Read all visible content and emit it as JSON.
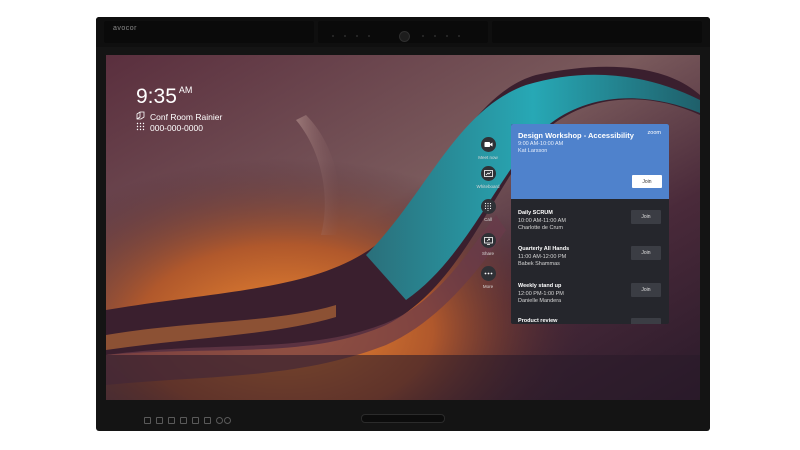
{
  "device": {
    "brand": "avocor"
  },
  "room": {
    "time": "9:35",
    "ampm": "AM",
    "name": "Conf Room Rainier",
    "phone": "000-000-0000"
  },
  "actions": [
    {
      "label": "Meet now",
      "icon": "video-camera-icon"
    },
    {
      "label": "Whiteboard",
      "icon": "whiteboard-icon"
    },
    {
      "label": "Call",
      "icon": "dialpad-icon"
    },
    {
      "label": "Share",
      "icon": "share-screen-icon"
    },
    {
      "label": "More",
      "icon": "more-dots-icon"
    }
  ],
  "featured": {
    "title": "Design Workshop - Accessibility",
    "time": "9:00 AM-10:00 AM",
    "organizer": "Kat Larsson",
    "provider": "zoom",
    "join_label": "Join"
  },
  "meetings": [
    {
      "title": "Daily SCRUM",
      "time": "10:00 AM-11:00 AM",
      "organizer": "Charlotte de Crum",
      "join_label": "Join"
    },
    {
      "title": "Quarterly All Hands",
      "time": "11:00 AM-12:00 PM",
      "organizer": "Babek Shammas",
      "join_label": "Join"
    },
    {
      "title": "Weekly stand up",
      "time": "12:00 PM-1:00 PM",
      "organizer": "Danielle Mandera",
      "join_label": "Join"
    },
    {
      "title": "Product review",
      "time": "",
      "organizer": "",
      "join_label": ""
    }
  ],
  "colors": {
    "featured_card": "#4f82cc",
    "panel": "#25262c",
    "bezel": "#141414"
  }
}
